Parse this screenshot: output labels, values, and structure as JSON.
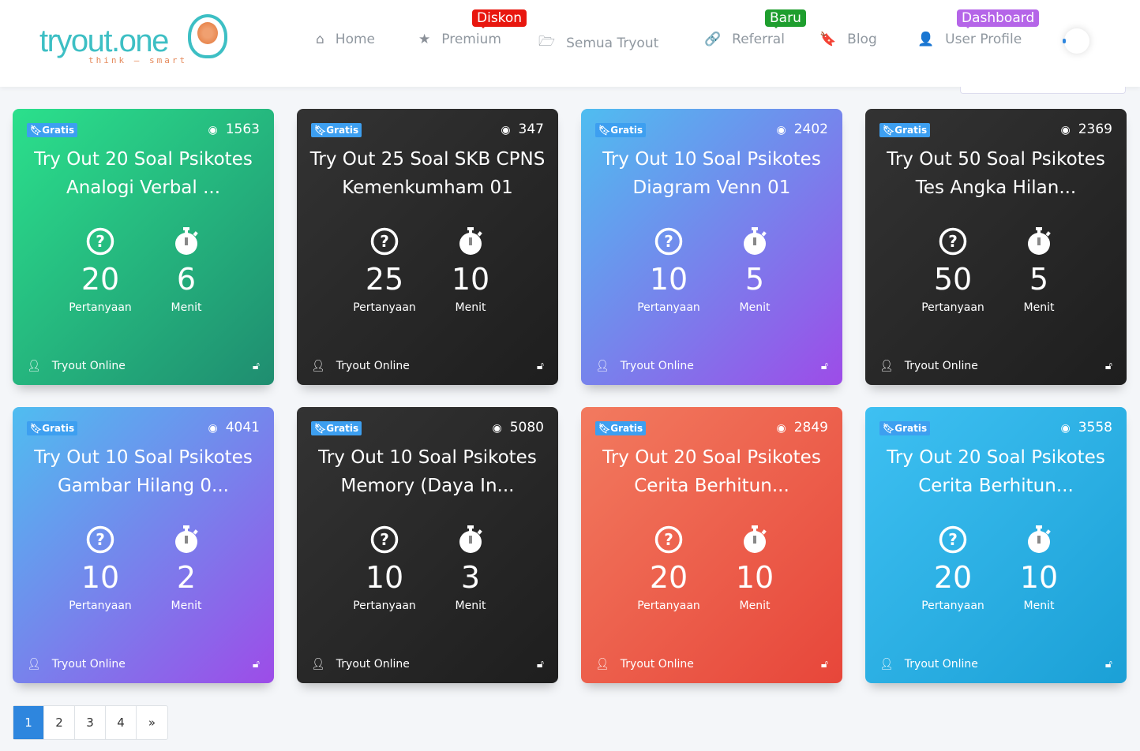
{
  "brand": {
    "name": "tryout.one",
    "tagline": "think — smart"
  },
  "nav": [
    {
      "label": "Home",
      "icon": "home-icon",
      "glyph": "⌂"
    },
    {
      "label": "Premium",
      "icon": "star-icon",
      "glyph": "★",
      "badge": "Diskon",
      "badge_color": "#e8170f"
    },
    {
      "label": "Semua Tryout",
      "icon": "folder-open-icon",
      "glyph": "🗁"
    },
    {
      "label": "Referral",
      "icon": "link-icon",
      "glyph": "🔗",
      "badge": "Baru",
      "badge_color": "#1e9e2e"
    },
    {
      "label": "Blog",
      "icon": "bookmark-icon",
      "glyph": "🔖"
    },
    {
      "label": "User Profile",
      "icon": "user-icon",
      "glyph": "👤",
      "badge": "Dashboard",
      "badge_color": "#b565e8"
    }
  ],
  "cards": [
    {
      "badge": "Gratis",
      "views": "1563",
      "title": "Try Out 20 Soal Psikotes Analogi Verbal ...",
      "questions": "20",
      "questions_label": "Pertanyaan",
      "minutes": "6",
      "minutes_label": "Menit",
      "footer": "Tryout Online",
      "theme": "green"
    },
    {
      "badge": "Gratis",
      "views": "347",
      "title": "Try Out 25 Soal SKB CPNS Kemenkumham 01",
      "questions": "25",
      "questions_label": "Pertanyaan",
      "minutes": "10",
      "minutes_label": "Menit",
      "footer": "Tryout Online",
      "theme": "dark"
    },
    {
      "badge": "Gratis",
      "views": "2402",
      "title": "Try Out 10 Soal Psikotes Diagram Venn 01",
      "questions": "10",
      "questions_label": "Pertanyaan",
      "minutes": "5",
      "minutes_label": "Menit",
      "footer": "Tryout Online",
      "theme": "purple"
    },
    {
      "badge": "Gratis",
      "views": "2369",
      "title": "Try Out 50 Soal Psikotes Tes Angka Hilan...",
      "questions": "50",
      "questions_label": "Pertanyaan",
      "minutes": "5",
      "minutes_label": "Menit",
      "footer": "Tryout Online",
      "theme": "dark"
    },
    {
      "badge": "Gratis",
      "views": "4041",
      "title": "Try Out 10 Soal Psikotes Gambar Hilang 0...",
      "questions": "10",
      "questions_label": "Pertanyaan",
      "minutes": "2",
      "minutes_label": "Menit",
      "footer": "Tryout Online",
      "theme": "purple"
    },
    {
      "badge": "Gratis",
      "views": "5080",
      "title": "Try Out 10 Soal Psikotes Memory (Daya In...",
      "questions": "10",
      "questions_label": "Pertanyaan",
      "minutes": "3",
      "minutes_label": "Menit",
      "footer": "Tryout Online",
      "theme": "dark"
    },
    {
      "badge": "Gratis",
      "views": "2849",
      "title": "Try Out 20 Soal Psikotes Cerita Berhitun...",
      "questions": "20",
      "questions_label": "Pertanyaan",
      "minutes": "10",
      "minutes_label": "Menit",
      "footer": "Tryout Online",
      "theme": "red"
    },
    {
      "badge": "Gratis",
      "views": "3558",
      "title": "Try Out 20 Soal Psikotes Cerita Berhitun...",
      "questions": "20",
      "questions_label": "Pertanyaan",
      "minutes": "10",
      "minutes_label": "Menit",
      "footer": "Tryout Online",
      "theme": "cyan"
    }
  ],
  "pagination": {
    "pages": [
      "1",
      "2",
      "3",
      "4"
    ],
    "next": "»",
    "current": "1"
  }
}
